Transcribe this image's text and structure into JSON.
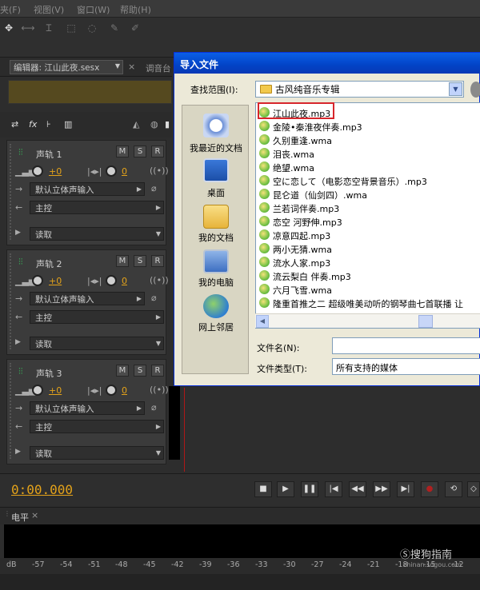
{
  "menu": [
    "夹(F)",
    "视图(V)",
    "窗口(W)",
    "帮助(H)"
  ],
  "editor_tab": {
    "label": "编辑器: 江山此夜.sesx",
    "mixer": "调音台"
  },
  "tracks": [
    {
      "name": "声轨 1",
      "volume": "+0",
      "pan": "0",
      "input": "默认立体声输入",
      "output": "主控",
      "mode": "读取"
    },
    {
      "name": "声轨 2",
      "volume": "+0",
      "pan": "0",
      "input": "默认立体声输入",
      "output": "主控",
      "mode": "读取"
    },
    {
      "name": "声轨 3",
      "volume": "+0",
      "pan": "0",
      "input": "默认立体声输入",
      "output": "主控",
      "mode": "读取"
    }
  ],
  "track_buttons": [
    "M",
    "S",
    "R"
  ],
  "transport": {
    "time": "0:00.000"
  },
  "level_panel": {
    "tab": "电平",
    "scale": [
      "dB",
      "-57",
      "-54",
      "-51",
      "-48",
      "-45",
      "-42",
      "-39",
      "-36",
      "-33",
      "-30",
      "-27",
      "-24",
      "-21",
      "-18",
      "-15",
      "-12"
    ]
  },
  "watermark": {
    "text": "搜狗指南",
    "url": "zhinan.sogou.com"
  },
  "dialog": {
    "title": "导入文件",
    "lookin_label": "查找范围(I):",
    "lookin_value": "古风纯音乐专辑",
    "places": [
      "我最近的文档",
      "桌面",
      "我的文档",
      "我的电脑",
      "网上邻居"
    ],
    "files": [
      "江山此夜.mp3",
      "金陵•秦淮夜伴奏.mp3",
      "久别重逢.wma",
      "泪丧.wma",
      "绝望.wma",
      "空に恋して（电影恋空背景音乐）.mp3",
      "昆仑道（仙剑四）.wma",
      "兰若词伴奏.mp3",
      "恋空 河野伸.mp3",
      "凉意四起.mp3",
      "两小无猜.wma",
      "流水人家.mp3",
      "流云梨白 伴奏.mp3",
      "六月飞雪.wma",
      "隆重首推之二 超级唯美动听的钢琴曲七首联播 让"
    ],
    "filename_label": "文件名(N):",
    "filename_value": "",
    "filetype_label": "文件类型(T):",
    "filetype_value": "所有支持的媒体"
  }
}
